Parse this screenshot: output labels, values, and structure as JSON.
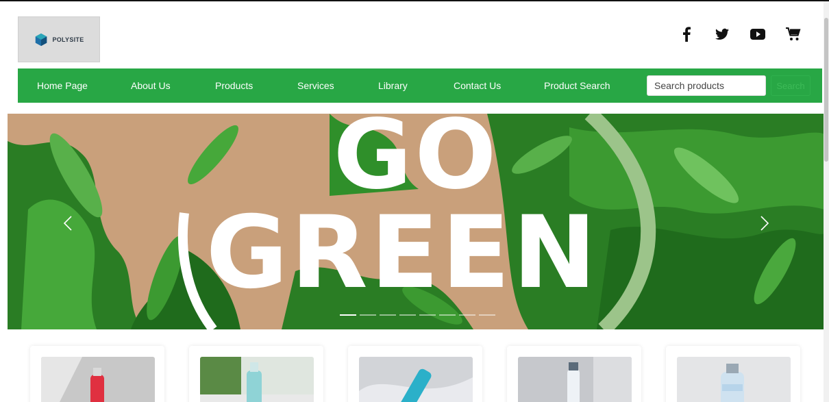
{
  "brand": {
    "name": "POLYSITE"
  },
  "social": {
    "facebook_icon": "facebook-icon",
    "twitter_icon": "twitter-icon",
    "youtube_icon": "youtube-icon",
    "cart_icon": "cart-icon"
  },
  "nav": {
    "items": [
      "Home Page",
      "About Us",
      "Products",
      "Services",
      "Library",
      "Contact Us",
      "Product Search"
    ]
  },
  "search": {
    "placeholder": "Search products",
    "value": "",
    "button_label": "Search"
  },
  "hero": {
    "line1": "GO",
    "line2": "GREEN",
    "slide_count": 8,
    "active_slide": 1
  },
  "products": {
    "count_visible": 5,
    "images": [
      "red-bottle-image",
      "teal-bottle-image",
      "blue-bottle-image",
      "white-bottle-image",
      "clear-bottle-image"
    ]
  },
  "colors": {
    "nav_green": "#28a745",
    "hero_bg": "#c9a07b",
    "leaf_dark": "#1d6b1a",
    "leaf_mid": "#2f8f2a",
    "leaf_light": "#58b04a"
  }
}
